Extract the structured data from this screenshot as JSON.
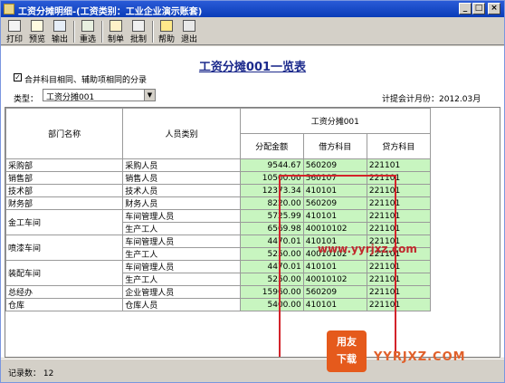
{
  "window": {
    "title": "工资分摊明细-(工资类别：工业企业演示账套)"
  },
  "window_controls": {
    "minimize": "_",
    "maximize": "□",
    "close": "×"
  },
  "toolbar": {
    "print": "打印",
    "preview": "预览",
    "export": "输出",
    "reselect": "重选",
    "make_voucher": "制单",
    "batch_voucher": "批制",
    "help": "帮助",
    "exit": "退出"
  },
  "report": {
    "title": "工资分摊001一览表",
    "merge_option": "合并科目相同、辅助项相同的分录",
    "merge_checked": true,
    "type_label": "类型：",
    "type_value": "工资分摊001",
    "period": "计提会计月份：2012.03月"
  },
  "table": {
    "headers": {
      "dept": "部门名称",
      "category": "人员类别",
      "group": "工资分摊001",
      "amount": "分配金额",
      "debit": "借方科目",
      "credit": "贷方科目"
    },
    "rows": [
      {
        "dept": "采购部",
        "category": "采购人员",
        "amount": "9544.67",
        "debit": "560209",
        "credit": "221101"
      },
      {
        "dept": "销售部",
        "category": "销售人员",
        "amount": "10500.00",
        "debit": "560107",
        "credit": "221101"
      },
      {
        "dept": "技术部",
        "category": "技术人员",
        "amount": "12373.34",
        "debit": "410101",
        "credit": "221101"
      },
      {
        "dept": "财务部",
        "category": "财务人员",
        "amount": "8220.00",
        "debit": "560209",
        "credit": "221101"
      },
      {
        "dept": "金工车间",
        "category": "车间管理人员",
        "amount": "5725.99",
        "debit": "410101",
        "credit": "221101"
      },
      {
        "dept": "",
        "category": "生产工人",
        "amount": "6569.98",
        "debit": "40010102",
        "credit": "221101"
      },
      {
        "dept": "喷漆车间",
        "category": "车间管理人员",
        "amount": "4470.01",
        "debit": "410101",
        "credit": "221101"
      },
      {
        "dept": "",
        "category": "生产工人",
        "amount": "5250.00",
        "debit": "40010102",
        "credit": "221101"
      },
      {
        "dept": "装配车间",
        "category": "车间管理人员",
        "amount": "4470.01",
        "debit": "410101",
        "credit": "221101"
      },
      {
        "dept": "",
        "category": "生产工人",
        "amount": "5250.00",
        "debit": "40010102",
        "credit": "221101"
      },
      {
        "dept": "总经办",
        "category": "企业管理人员",
        "amount": "15960.00",
        "debit": "560209",
        "credit": "221101"
      },
      {
        "dept": "仓库",
        "category": "仓库人员",
        "amount": "5400.00",
        "debit": "410101",
        "credit": "221101"
      }
    ]
  },
  "status": {
    "record_count": "记录数：  12"
  },
  "watermark": {
    "url": "www.yyrjxz.com",
    "logo_top": "用友",
    "logo_bottom": "下载",
    "site": "YYRJXZ.COM"
  },
  "colors": {
    "green_cell": "#c8f5c0",
    "highlight_border": "#d3232a",
    "title_blue": "#1c2a8c"
  }
}
